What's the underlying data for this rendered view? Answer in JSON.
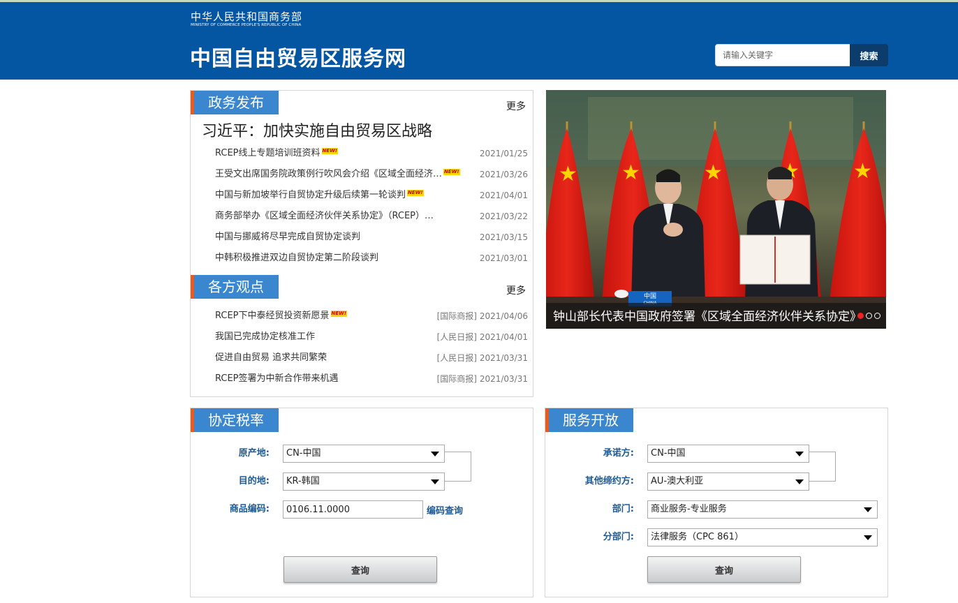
{
  "header": {
    "ministry_cn": "中华人民共和国商务部",
    "ministry_en": "MINISTRY OF COMMERCE PEOPLE'S REPUBLIC OF CHINA",
    "site_title": "中国自由贸易区服务网",
    "search_placeholder": "请输入关键字",
    "search_button": "搜索"
  },
  "news": {
    "tab": "政务发布",
    "more": "更多",
    "headline": "习近平：加快实施自由贸易区战略",
    "new_badge": "NEW!",
    "items": [
      {
        "title": "RCEP线上专题培训班资料",
        "date": "2021/01/25",
        "new": true
      },
      {
        "title": "王受文出席国务院政策例行吹风会介绍《区域全面经济…",
        "date": "2021/03/26",
        "new": true
      },
      {
        "title": "中国与新加坡举行自贸协定升级后续第一轮谈判",
        "date": "2021/04/01",
        "new": true
      },
      {
        "title": "商务部举办《区域全面经济伙伴关系协定》（RCEP）…",
        "date": "2021/03/22",
        "new": false
      },
      {
        "title": "中国与挪威将尽早完成自贸协定谈判",
        "date": "2021/03/15",
        "new": false
      },
      {
        "title": "中韩积极推进双边自贸协定第二阶段谈判",
        "date": "2021/03/01",
        "new": false
      }
    ]
  },
  "views": {
    "tab": "各方观点",
    "more": "更多",
    "items": [
      {
        "title": "RCEP下中泰经贸投资新愿景",
        "source": "[国际商报]",
        "date": "2021/04/06",
        "new": true
      },
      {
        "title": "我国已完成协定核准工作",
        "source": "[人民日报]",
        "date": "2021/04/01",
        "new": false
      },
      {
        "title": "促进自由贸易 追求共同繁荣",
        "source": "[人民日报]",
        "date": "2021/03/31",
        "new": false
      },
      {
        "title": "RCEP签署为中新合作带来机遇",
        "source": "[国际商报]",
        "date": "2021/03/31",
        "new": false
      }
    ]
  },
  "slider": {
    "caption": "钟山部长代表中国政府签署《区域全面经济伙伴关系协定》",
    "desk_sign": "中国",
    "desk_sign_en": "CHINA",
    "slide_count": 3,
    "active_slide": 1
  },
  "tariff": {
    "tab": "协定税率",
    "origin_label": "原产地:",
    "origin_value": "CN-中国",
    "dest_label": "目的地:",
    "dest_value": "KR-韩国",
    "code_label": "商品编码:",
    "code_value": "0106.11.0000",
    "code_link": "编码查询",
    "query_button": "查询"
  },
  "service": {
    "tab": "服务开放",
    "promisor_label": "承诺方:",
    "promisor_value": "CN-中国",
    "other_label": "其他缔约方:",
    "other_value": "AU-澳大利亚",
    "dept_label": "部门:",
    "dept_value": "商业服务-专业服务",
    "subdept_label": "分部门:",
    "subdept_value": "法律服务（CPC 861）",
    "query_button": "查询"
  },
  "colors": {
    "header_bg": "#0456a3",
    "tab_bg": "#3a87cf",
    "tab_accent": "#e85b1f",
    "label_blue": "#1d5a94"
  }
}
